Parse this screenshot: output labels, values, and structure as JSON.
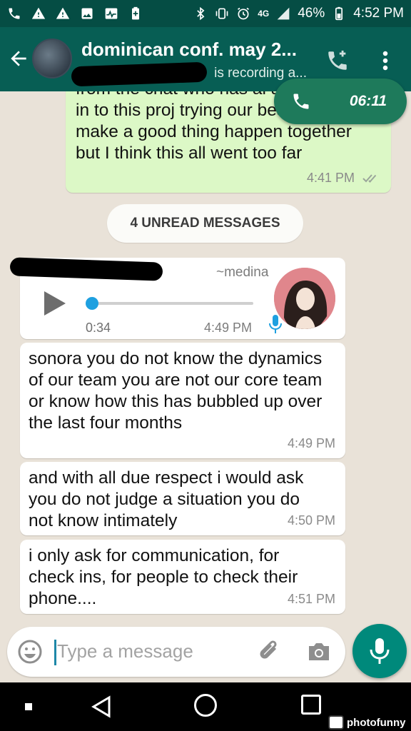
{
  "status_bar": {
    "battery": "46%",
    "network": "4G",
    "time": "4:52 PM"
  },
  "header": {
    "title": "dominican conf. may 2...",
    "subtitle": "is recording a..."
  },
  "call": {
    "timer": "06:11"
  },
  "messages": [
    {
      "direction": "out",
      "text": "from the chat who has al all this work in to this proj trying our best, trying to make a good thing happen together but I think this all went too far",
      "time": "4:41 PM"
    },
    {
      "direction": "in",
      "text": "sonora you do not know the dynamics of our team you are not our core team or know how this has bubbled up over the last four months",
      "time": "4:49 PM"
    },
    {
      "direction": "in",
      "text": "and with all due respect i would ask you do not judge a situation you do not know intimately",
      "time": "4:50 PM"
    },
    {
      "direction": "in",
      "text": "i only ask for communication, for check ins, for people to check their phone....",
      "time": "4:51 PM"
    }
  ],
  "unread_label": "4 UNREAD MESSAGES",
  "voice_note": {
    "sender": "~medina",
    "duration": "0:34",
    "time": "4:49 PM",
    "progress": 0
  },
  "composer": {
    "placeholder": "Type a message"
  },
  "watermark": "photofunny",
  "colors": {
    "app_bar": "#075e54",
    "status_bar": "#054d44",
    "outgoing_bubble": "#dcf8c6",
    "incoming_bubble": "#ffffff",
    "call_pill": "#1e7a5b",
    "fab": "#00897b",
    "voice_progress": "#1ea0e0"
  },
  "icons": {
    "status_left": [
      "phone-icon",
      "warning-icon",
      "warning-icon",
      "image-icon",
      "activity-icon",
      "battery-plus-icon"
    ],
    "status_right": [
      "bluetooth-icon",
      "vibrate-icon",
      "alarm-icon",
      "signal-icon",
      "battery-icon"
    ]
  }
}
